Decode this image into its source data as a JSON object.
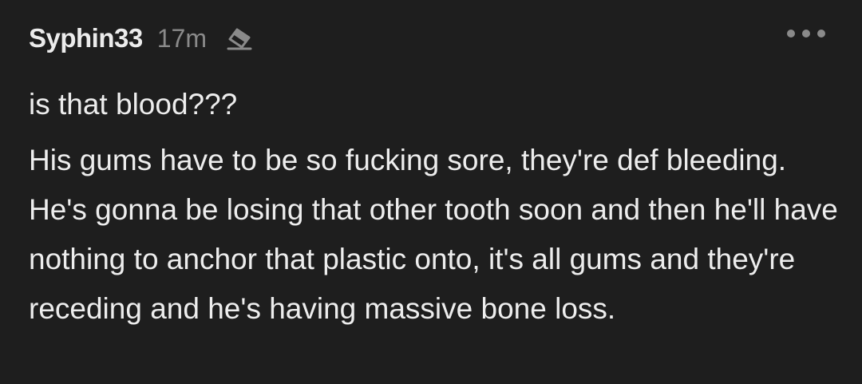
{
  "comment": {
    "username": "Syphin33",
    "timestamp": "17m",
    "edit_icon": "eraser-icon",
    "more_icon": "more-horizontal-icon",
    "paragraphs": [
      "is that blood???",
      "His gums have to be so fucking sore, they're def bleeding. He's gonna be losing that other tooth soon and then he'll have nothing to anchor that plastic onto, it's all gums and they're receding and he's having massive bone loss."
    ]
  },
  "colors": {
    "background": "#1e1e1e",
    "text": "#ededed",
    "muted": "#8a8a8a"
  }
}
